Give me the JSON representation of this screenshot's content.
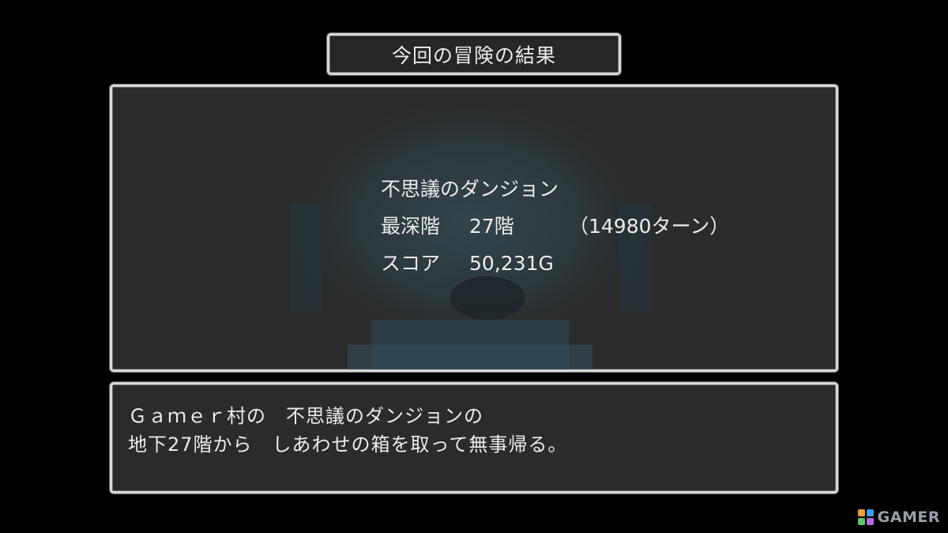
{
  "title": "今回の冒険の結果",
  "stats": {
    "dungeon_name": "不思議のダンジョン",
    "depth_label": "最深階",
    "depth_value": "27階",
    "turns": "（14980ターン）",
    "score_label": "スコア",
    "score_value": "50,231G"
  },
  "message": {
    "line1": "Ｇａｍｅｒ村の　不思議のダンジョンの",
    "line2": "地下27階から　しあわせの箱を取って無事帰る。"
  },
  "watermark": {
    "text": "GAMER",
    "icon": "gamer-logo-icon"
  },
  "colors": {
    "background": "#000000",
    "panel": "#2b2b2b",
    "border": "#d8d8d8",
    "text": "#ececec",
    "art_tint": "#2f4a55"
  }
}
